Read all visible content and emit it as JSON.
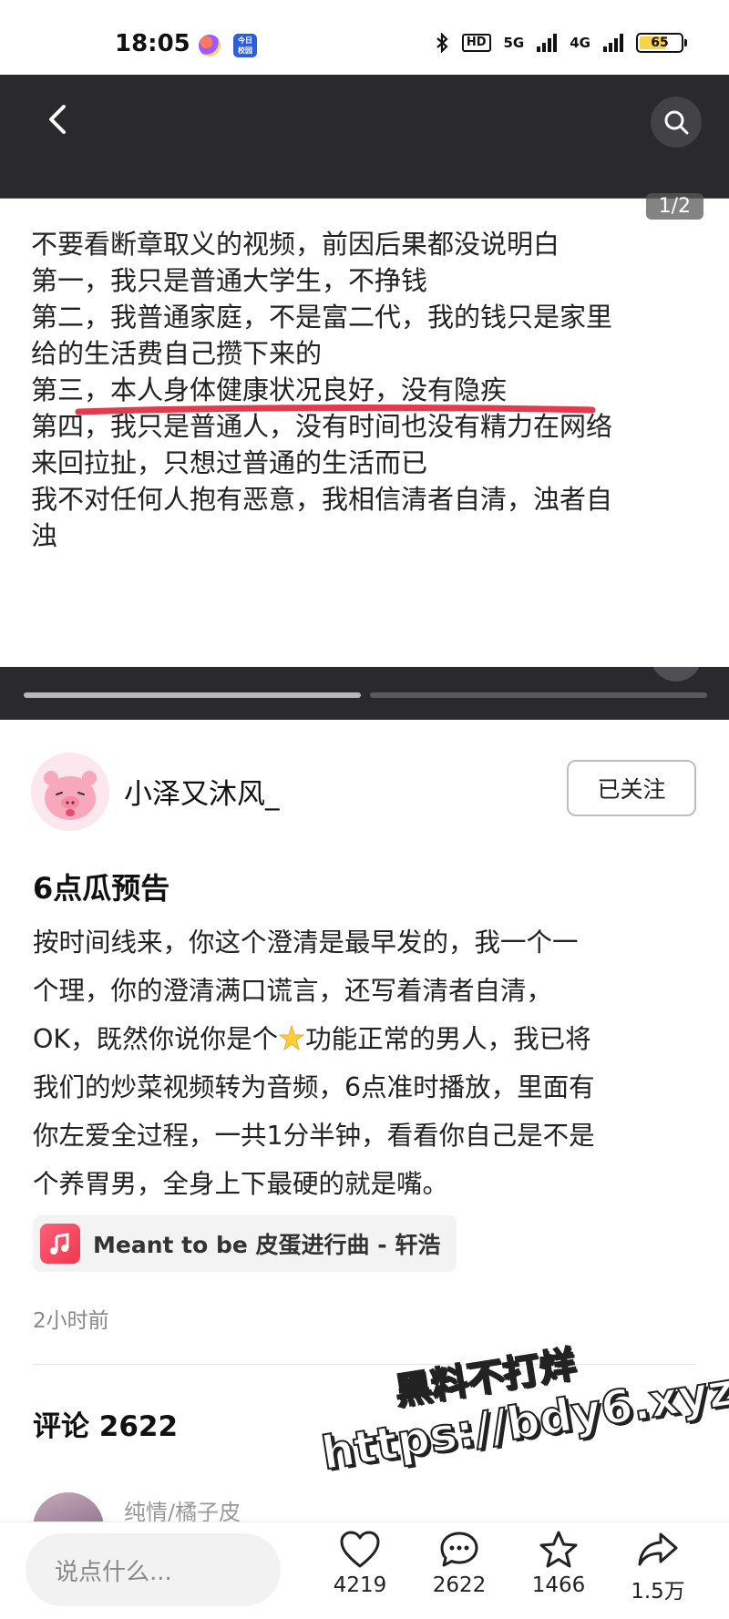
{
  "status_bar": {
    "time": "18:05",
    "app_badge_text": "今日\n校园",
    "network_1": "5G",
    "network_2": "4G",
    "hd": "HD",
    "battery": "65"
  },
  "media": {
    "page_indicator": "1/2",
    "slide_lines": [
      "不要看断章取义的视频，前因后果都没说明白",
      "第一，我只是普通大学生，不挣钱",
      "第二，我普通家庭，不是富二代，我的钱只是家里",
      "给的生活费自己攒下来的",
      "第三，本人身体健康状况良好，没有隐疾",
      "第四，我只是普通人，没有时间也没有精力在网络",
      "来回拉扯，只想过普通的生活而已",
      "我不对任何人抱有恶意，我相信清者自清，浊者自",
      "浊"
    ],
    "highlight_color": "#e23a4e",
    "slide_count": 2,
    "current_slide": 1
  },
  "author": {
    "name": "小泽又沐风_",
    "follow_label": "已关注"
  },
  "post": {
    "title": "6点瓜预告",
    "body_lines": [
      "按时间线来，你这个澄清是最早发的，我一个一",
      "个理，你的澄清满口谎言，还写着清者自清，",
      "OK，既然你说你是个",
      "功能正常的男人，我已将",
      "我们的炒菜视频转为音频，6点准时播放，里面有",
      "你左爱全过程，一共1分半钟，看看你自己是不是",
      "个养胃男，全身上下最硬的就是嘴。"
    ],
    "music": "Meant to be 皮蛋进行曲 - 轩浩",
    "time_ago": "2小时前"
  },
  "comments": {
    "title": "评论 2622",
    "first_user": "纯情/橘子皮"
  },
  "watermark": {
    "line1": "黑料不打烊",
    "line2": "https://bdy6.xyz"
  },
  "bottom_bar": {
    "input_placeholder": "说点什么...",
    "likes": "4219",
    "comments": "2622",
    "favorites": "1466",
    "shares": "1.5万"
  },
  "colors": {
    "accent_red": "#e23a4e",
    "media_bg": "#2a2a2c",
    "text": "#161823",
    "muted": "#888888"
  }
}
